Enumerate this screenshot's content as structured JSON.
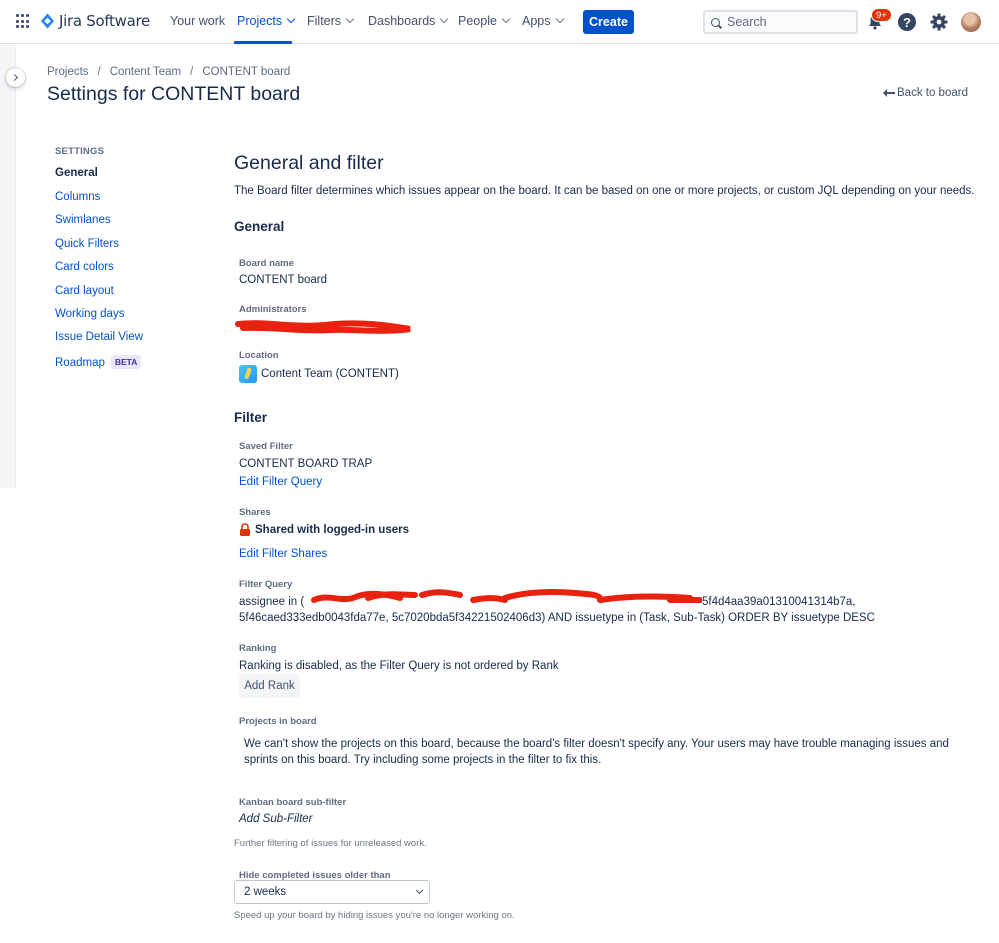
{
  "topnav": {
    "product": "Jira Software",
    "items": [
      {
        "label": "Your work"
      },
      {
        "label": "Projects"
      },
      {
        "label": "Filters"
      },
      {
        "label": "Dashboards"
      },
      {
        "label": "People"
      },
      {
        "label": "Apps"
      }
    ],
    "create_label": "Create",
    "search_placeholder": "Search",
    "notifications_badge": "9+",
    "help_glyph": "?",
    "colors": {
      "accent": "#0052cc",
      "badge": "#de350b"
    }
  },
  "breadcrumb": [
    "Projects",
    "Content Team",
    "CONTENT board"
  ],
  "breadcrumb_sep": "/",
  "page_title": "Settings for CONTENT board",
  "back_label": "Back to board",
  "back_icon": "arrow-back-icon",
  "sidebar": {
    "heading": "SETTINGS",
    "items": [
      {
        "label": "General",
        "current": true
      },
      {
        "label": "Columns"
      },
      {
        "label": "Swimlanes"
      },
      {
        "label": "Quick Filters"
      },
      {
        "label": "Card colors"
      },
      {
        "label": "Card layout"
      },
      {
        "label": "Working days"
      },
      {
        "label": "Issue Detail View"
      },
      {
        "label": "Roadmap",
        "badge": "BETA"
      }
    ]
  },
  "main": {
    "title": "General and filter",
    "description": "The Board filter determines which issues appear on the board. It can be based on one or more projects, or custom JQL depending on your needs.",
    "general": {
      "heading": "General",
      "board_name_label": "Board name",
      "board_name": "CONTENT board",
      "administrators_label": "Administrators",
      "location_label": "Location",
      "location": "Content Team (CONTENT)"
    },
    "filter": {
      "heading": "Filter",
      "saved_filter_label": "Saved Filter",
      "saved_filter": "CONTENT BOARD TRAP",
      "edit_filter_query": "Edit Filter Query",
      "shares_label": "Shares",
      "shares": "Shared with logged-in users",
      "edit_filter_shares": "Edit Filter Shares",
      "filter_query_label": "Filter Query",
      "filter_query_line1_prefix": "assignee in (",
      "filter_query_line1_suffix": "5f4d4aa39a01310041314b7a,",
      "filter_query_line2": "5f46caed333edb0043fda77e, 5c7020bda5f34221502406d3) AND issuetype in (Task, Sub-Task) ORDER BY issuetype DESC",
      "ranking_label": "Ranking",
      "ranking": "Ranking is disabled, as the Filter Query is not ordered by Rank",
      "add_rank": "Add Rank",
      "projects_label": "Projects in board",
      "projects_warning": "We can't show the projects on this board, because the board's filter doesn't specify any. Your users may have trouble managing issues and sprints on this board. Try including some projects in the filter to fix this.",
      "subfilter_label": "Kanban board sub-filter",
      "add_subfilter": "Add Sub-Filter",
      "subfilter_help": "Further filtering of issues for unreleased work.",
      "hide_label": "Hide completed issues older than",
      "hide_value": "2 weeks",
      "hide_help": "Speed up your board by hiding issues you're no longer working on."
    }
  }
}
